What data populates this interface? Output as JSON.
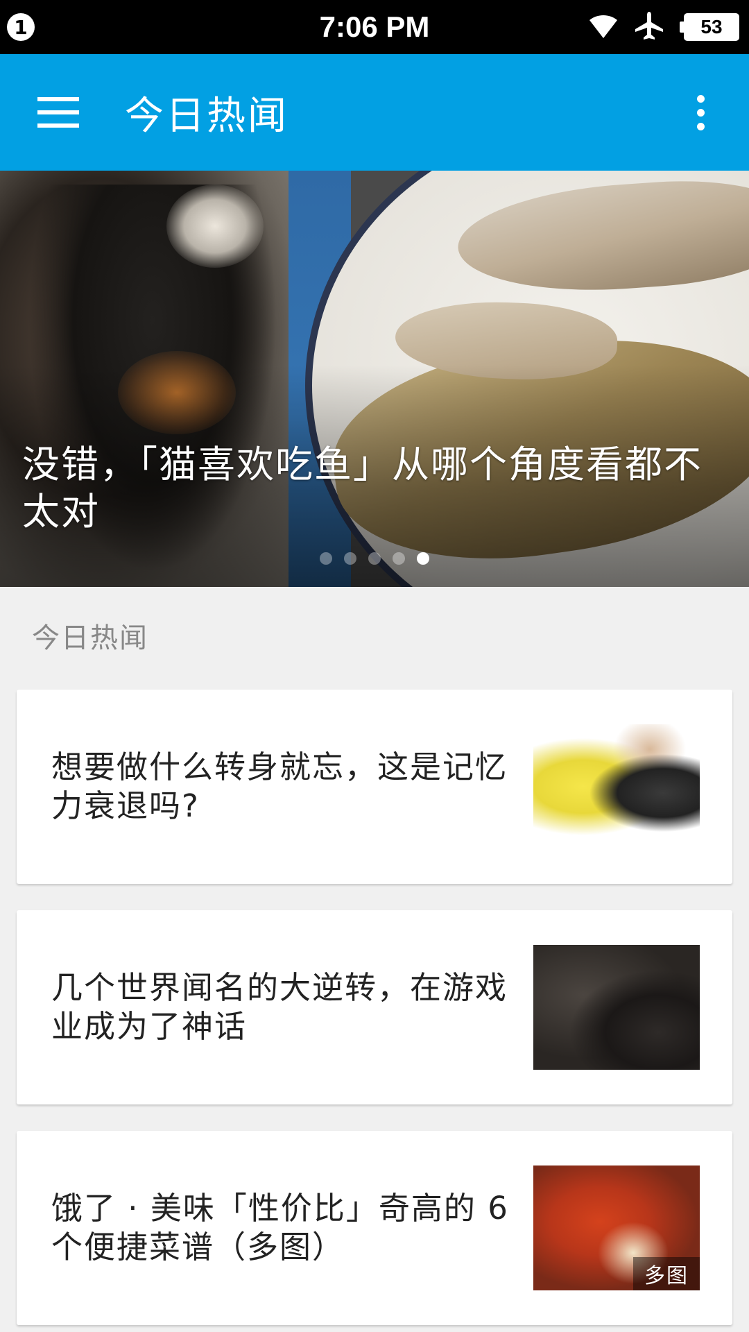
{
  "status_bar": {
    "notification_count": "1",
    "time": "7:06 PM",
    "battery_level": "53",
    "icons": [
      "wifi-icon",
      "airplane-mode-icon",
      "battery-icon"
    ]
  },
  "app_bar": {
    "title": "今日热闻",
    "background_color": "#02a0e3",
    "icons": [
      "menu-icon",
      "more-options-icon"
    ]
  },
  "hero": {
    "title": "没错，「猫喜欢吃鱼」从哪个角度看都不太对",
    "slide_count": 5,
    "active_slide_index": 4
  },
  "section": {
    "title": "今日热闻"
  },
  "stories": [
    {
      "title": "想要做什么转身就忘，这是记忆力衰退吗?",
      "has_multi_image": false
    },
    {
      "title": "几个世界闻名的大逆转，在游戏业成为了神话",
      "has_multi_image": false
    },
    {
      "title": "饿了 · 美味「性价比」奇高的 6 个便捷菜谱（多图）",
      "has_multi_image": true,
      "badge": "多图"
    }
  ]
}
